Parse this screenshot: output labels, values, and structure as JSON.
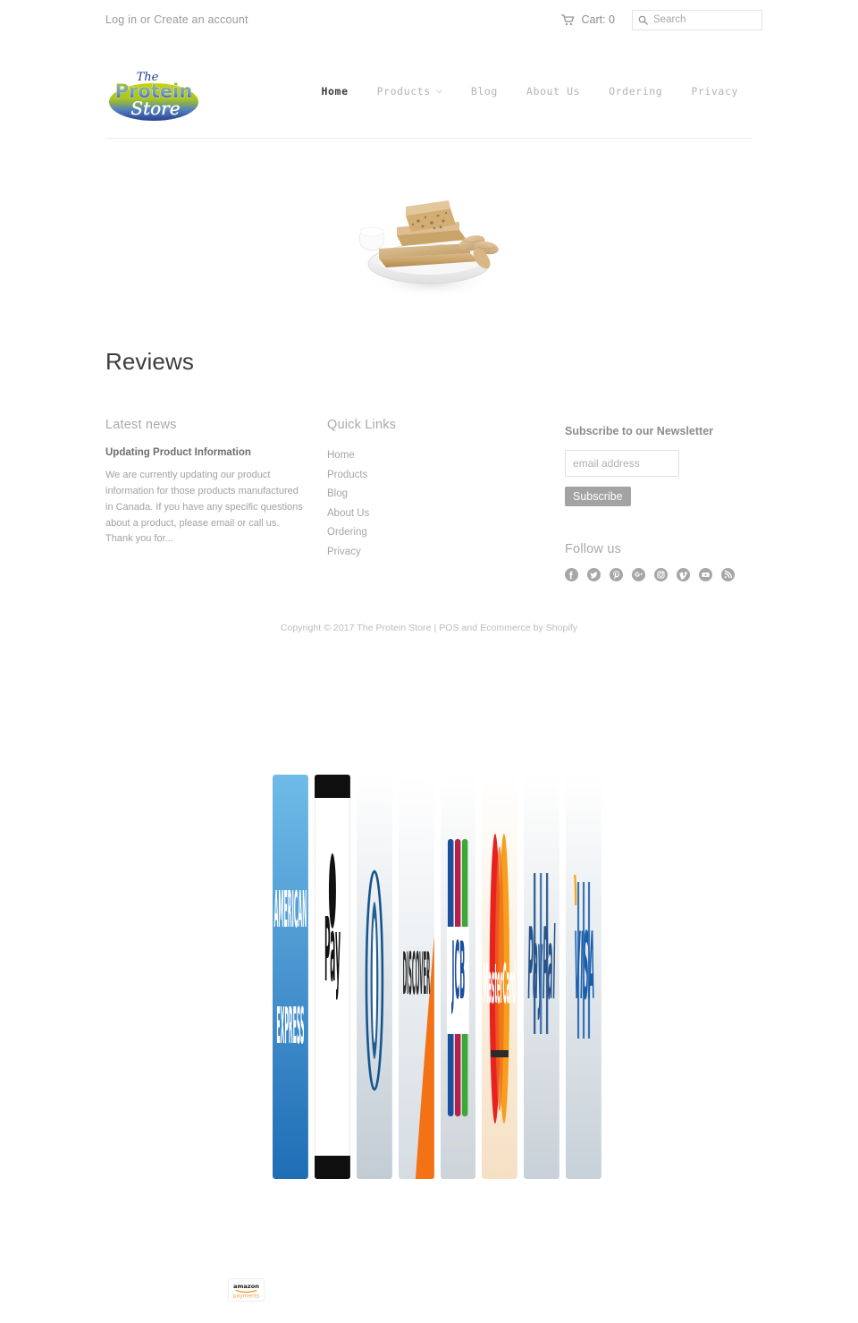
{
  "topbar": {
    "login_label": "Log in",
    "or_label": " or ",
    "create_account_label": "Create an account",
    "cart_label": "Cart: 0",
    "cart_icon": "shopping-cart-icon",
    "search_icon": "search-icon",
    "search_placeholder": "Search",
    "search_value": ""
  },
  "header": {
    "logo_alt": "The Protein Store",
    "logo_line1": "The",
    "logo_line2": "Protein",
    "logo_line3": "Store",
    "nav": [
      {
        "label": "Home",
        "active": true,
        "has_caret": false
      },
      {
        "label": "Products",
        "active": false,
        "has_caret": true
      },
      {
        "label": "Blog",
        "active": false,
        "has_caret": false
      },
      {
        "label": "About Us",
        "active": false,
        "has_caret": false
      },
      {
        "label": "Ordering",
        "active": false,
        "has_caret": false
      },
      {
        "label": "Privacy",
        "active": false,
        "has_caret": false
      }
    ]
  },
  "hero": {
    "image_alt": "Protein bars on a white plate with peanuts"
  },
  "main": {
    "page_title": "Reviews"
  },
  "footer": {
    "latest_news": {
      "heading": "Latest news",
      "post_title": "Updating Product Information",
      "post_excerpt": "We are currently updating our product information for those products manufactured in Canada.  If you have any specific questions about a product, please email or call us.  Thank you for..."
    },
    "quick_links": {
      "heading": "Quick Links",
      "items": [
        {
          "label": "Home"
        },
        {
          "label": "Products"
        },
        {
          "label": "Blog"
        },
        {
          "label": "About Us"
        },
        {
          "label": "Ordering"
        },
        {
          "label": "Privacy"
        }
      ]
    },
    "newsletter": {
      "heading": "Subscribe to our Newsletter",
      "email_placeholder": "email address",
      "email_value": "",
      "subscribe_label": "Subscribe"
    },
    "follow": {
      "heading": "Follow us",
      "icons": [
        {
          "name": "facebook-icon",
          "label": "Facebook"
        },
        {
          "name": "twitter-icon",
          "label": "Twitter"
        },
        {
          "name": "pinterest-icon",
          "label": "Pinterest"
        },
        {
          "name": "google-plus-icon",
          "label": "Google Plus"
        },
        {
          "name": "instagram-icon",
          "label": "Instagram"
        },
        {
          "name": "vimeo-icon",
          "label": "Vimeo"
        },
        {
          "name": "youtube-icon",
          "label": "YouTube"
        },
        {
          "name": "rss-icon",
          "label": "RSS"
        }
      ]
    },
    "copyright": "Copyright © 2017 The Protein Store | POS and Ecommerce by Shopify",
    "copyright_parts": {
      "prefix": "Copyright © 2017 The Protein Store | ",
      "pos": "POS",
      "middle": " and ",
      "ecommerce": "Ecommerce by Shopify"
    }
  },
  "payment_methods": [
    {
      "name": "american-express",
      "label": "AMERICAN EXPRESS"
    },
    {
      "name": "apple-pay",
      "label": "Apple Pay"
    },
    {
      "name": "diners-club",
      "label": "Diners Club"
    },
    {
      "name": "discover",
      "label": "DISCOVER"
    },
    {
      "name": "jcb",
      "label": "JCB"
    },
    {
      "name": "master",
      "label": "MasterCard"
    },
    {
      "name": "paypal",
      "label": "PayPal"
    },
    {
      "name": "visa",
      "label": "VISA"
    }
  ],
  "amazon_payments": {
    "name": "amazon-payments-badge",
    "line1": "amazon",
    "line2": "payments"
  },
  "colors": {
    "text_muted": "#a2a2a2",
    "text_dark": "#3d3d3d",
    "rule": "#ececec",
    "button_bg": "#a3a3a3",
    "amex_blue": "#2e77bb",
    "visa_blue": "#1a5eab",
    "mastercard_red": "#e8221f",
    "mastercard_orange": "#f79e1b",
    "discover_orange": "#f47216",
    "paypal_blue": "#26538a",
    "jcb_blue": "#1a4f9c",
    "jcb_red": "#b4224b",
    "jcb_green": "#3aa935"
  }
}
